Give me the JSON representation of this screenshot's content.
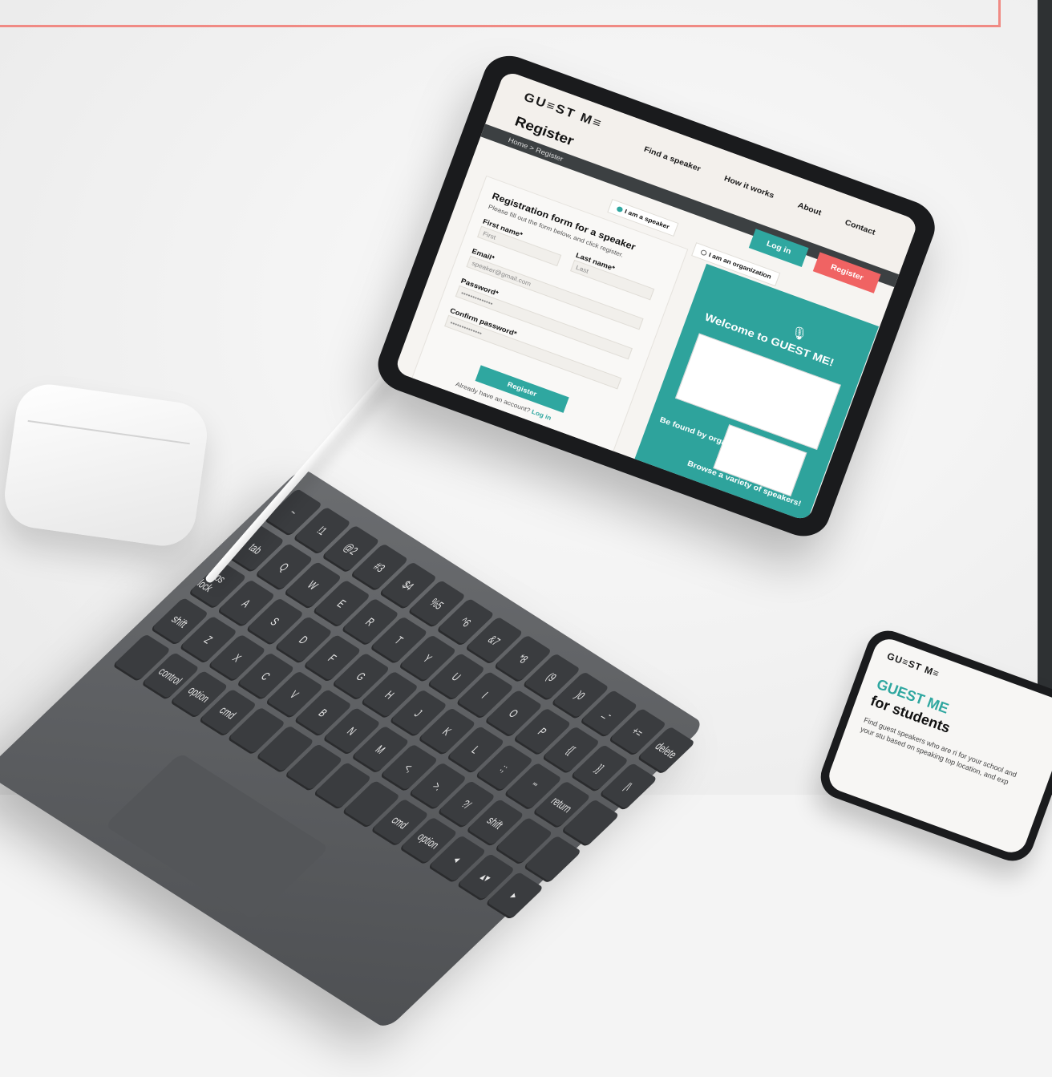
{
  "tablet": {
    "logo": "GU≡ST M≡",
    "page_title": "Register",
    "breadcrumb": "Home > Register",
    "nav": [
      "Find a speaker",
      "How it works",
      "About",
      "Contact"
    ],
    "buttons": {
      "login": "Log in",
      "register": "Register"
    },
    "form": {
      "title": "Registration form for a speaker",
      "subtitle": "Please fill out the form below, and click register.",
      "labels": {
        "first_name": "First name*",
        "last_name": "Last name*",
        "email": "Email*",
        "password": "Password*",
        "confirm_password": "Confirm password*"
      },
      "placeholders": {
        "first_name": "First",
        "last_name": "Last",
        "email": "speaker@gmail.com",
        "password": "••••••••••••••",
        "confirm_password": "••••••••••••••"
      },
      "submit": "Register",
      "account_text": "Already have an account?",
      "account_link": "Log in"
    },
    "radios": {
      "speaker": "I am a speaker",
      "organization": "I am an organization"
    },
    "promo": {
      "welcome": "Welcome to GUEST ME!",
      "line1": "Be found by organizers!",
      "line2": "Browse a variety of speakers!"
    }
  },
  "keyboard": {
    "keys": [
      "~",
      "!1",
      "@2",
      "#3",
      "$4",
      "%5",
      "^6",
      "&7",
      "*8",
      "(9",
      ")0",
      "_-",
      "+=",
      "delete",
      "tab",
      "Q",
      "W",
      "E",
      "R",
      "T",
      "Y",
      "U",
      "I",
      "O",
      "P",
      "{[",
      "}]",
      "|\\",
      "caps lock",
      "A",
      "S",
      "D",
      "F",
      "G",
      "H",
      "J",
      "K",
      "L",
      ":;",
      "\"'",
      "return",
      "",
      "shift",
      "Z",
      "X",
      "C",
      "V",
      "B",
      "N",
      "M",
      "<,",
      ">.",
      "?/",
      "shift",
      "",
      "",
      "",
      "control",
      "option",
      "cmd",
      "",
      "",
      "",
      "",
      "",
      "cmd",
      "option",
      "◂",
      "▴▾",
      "▸"
    ]
  },
  "phone": {
    "logo": "GU≡ST M≡",
    "title": "GUEST ME",
    "subtitle": "for students",
    "text": "Find guest speakers who are ri for your school and your stu based on speaking top location, and exp"
  }
}
